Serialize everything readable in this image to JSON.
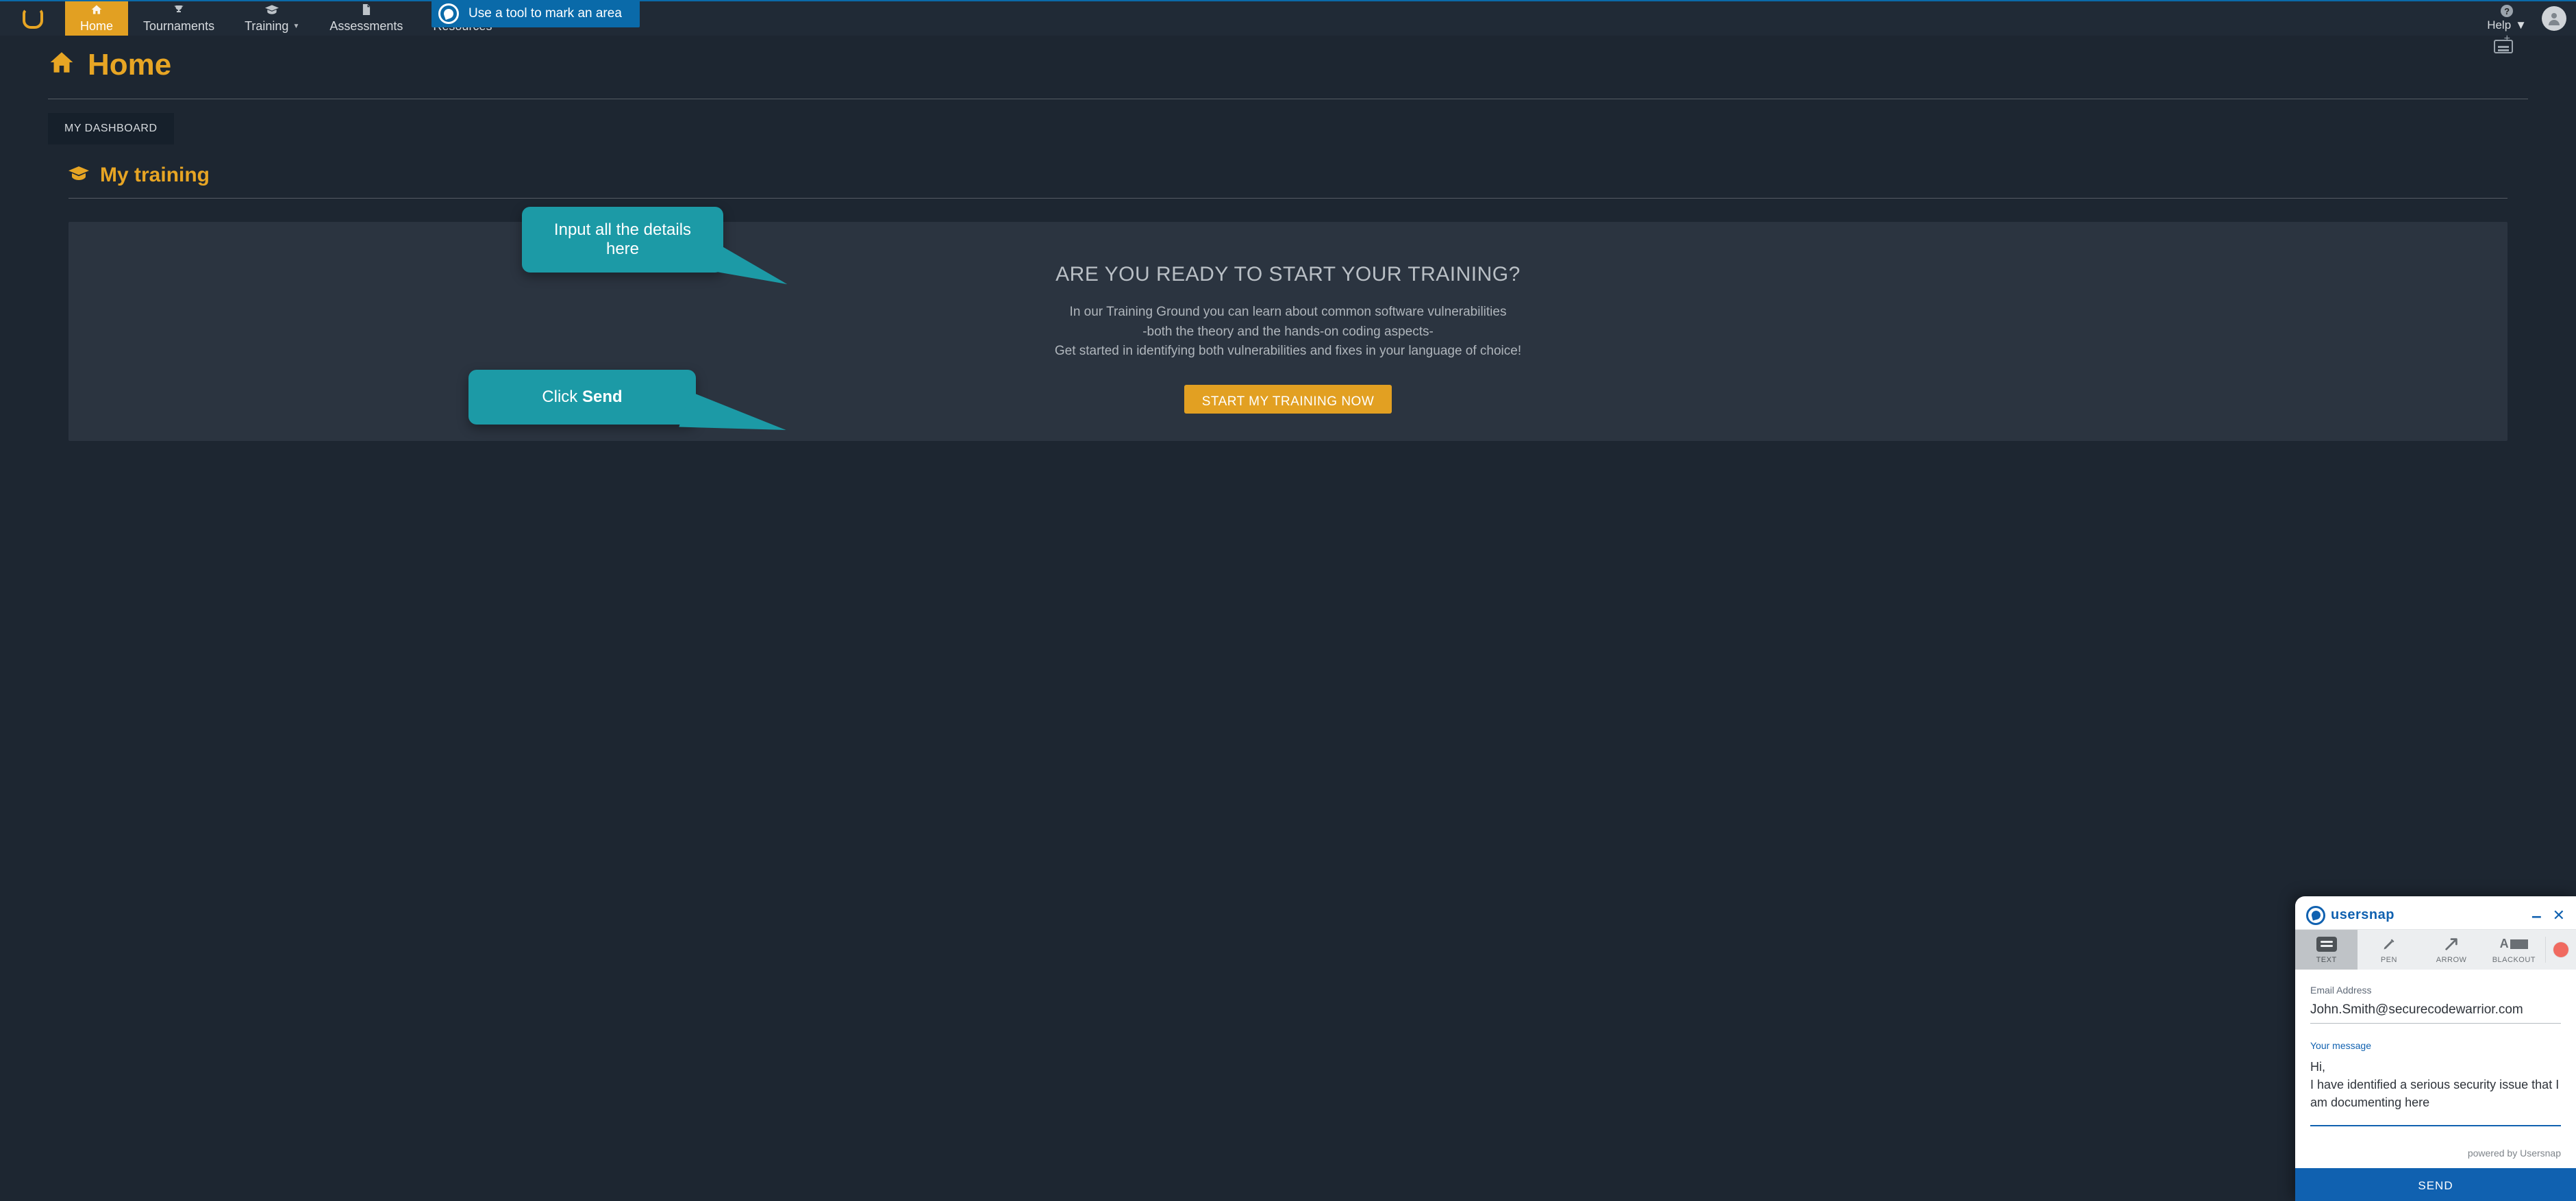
{
  "nav": {
    "items": [
      {
        "label": "Home",
        "icon": "home-icon"
      },
      {
        "label": "Tournaments",
        "icon": "trophy-icon"
      },
      {
        "label": "Training",
        "icon": "graduation-icon",
        "caret": "▼"
      },
      {
        "label": "Assessments",
        "icon": "document-icon"
      },
      {
        "label": "Resources",
        "icon": "presentation-icon"
      }
    ],
    "help": {
      "label": "Help",
      "caret": "▼"
    }
  },
  "tool_banner": "Use a tool to mark an area",
  "page": {
    "title": "Home",
    "tab": "MY DASHBOARD",
    "section_title": "My training",
    "training": {
      "headline": "ARE YOU READY TO START YOUR TRAINING?",
      "line1": "In our Training Ground you can learn about common software vulnerabilities",
      "line2": "-both the theory and the hands-on coding aspects-",
      "line3": "Get started in identifying both vulnerabilities and fixes in your language of choice!",
      "button": "START MY TRAINING NOW"
    }
  },
  "callouts": {
    "c1_line1": "Input all the details",
    "c1_line2": "here",
    "c2_prefix": "Click ",
    "c2_bold": "Send"
  },
  "usersnap": {
    "brand": "usersnap",
    "tools": [
      {
        "label": "TEXT"
      },
      {
        "label": "PEN"
      },
      {
        "label": "ARROW"
      },
      {
        "label": "BLACKOUT"
      }
    ],
    "email_label": "Email Address",
    "email_value": "John.Smith@securecodewarrior.com",
    "message_label": "Your message",
    "message_value": "Hi,\nI have identified a serious security issue that I am documenting here",
    "powered": "powered by Usersnap",
    "send": "SEND"
  }
}
